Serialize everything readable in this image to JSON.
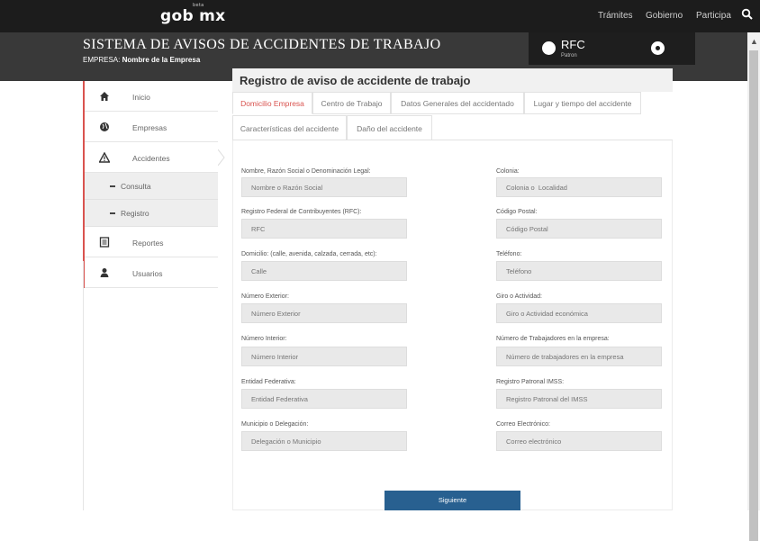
{
  "topbar": {
    "logo_text": "gob mx",
    "logo_badge": "beta",
    "nav": [
      "Trámites",
      "Gobierno",
      "Participa"
    ]
  },
  "header": {
    "title": "SISTEMA DE AVISOS DE ACCIDENTES DE TRABAJO",
    "empresa_label": "EMPRESA:",
    "empresa_value": "Nombre de la Empresa",
    "rfc": "RFC",
    "rfc_sub": "Patron"
  },
  "sidebar": {
    "items": [
      {
        "label": "Inicio",
        "icon": "home-icon"
      },
      {
        "label": "Empresas",
        "icon": "globe-icon"
      },
      {
        "label": "Accidentes",
        "icon": "warning-icon"
      },
      {
        "label": "Consulta",
        "icon": "dash-icon"
      },
      {
        "label": "Registro",
        "icon": "dash-icon"
      },
      {
        "label": "Reportes",
        "icon": "report-icon"
      },
      {
        "label": "Usuarios",
        "icon": "user-icon"
      }
    ]
  },
  "main": {
    "title": "Registro de aviso de accidente de trabajo",
    "tabs": [
      "Domicilio Empresa",
      "Centro de Trabajo",
      "Datos Generales del accidentado",
      "Lugar y tiempo del accidente",
      "Características del accidente",
      "Daño del accidente"
    ],
    "form": {
      "left": [
        {
          "label": "Nombre, Razón Social o Denominación Legal:",
          "placeholder": "Nombre o Razón Social"
        },
        {
          "label": "Registro Federal de Contribuyentes (RFC):",
          "placeholder": "RFC"
        },
        {
          "label": "Domicilio: (calle, avenida, calzada, cerrada, etc):",
          "placeholder": "Calle"
        },
        {
          "label": "Número Exterior:",
          "placeholder": "Número Exterior"
        },
        {
          "label": "Número Interior:",
          "placeholder": "Número Interior"
        },
        {
          "label": "Entidad Federativa:",
          "placeholder": "Entidad Federativa"
        },
        {
          "label": "Municipio o Delegación:",
          "placeholder": "Delegación o Municipio"
        }
      ],
      "right": [
        {
          "label": "Colonia:",
          "placeholder": "Colonia o  Localidad"
        },
        {
          "label": "Código Postal:",
          "placeholder": "Código Postal"
        },
        {
          "label": "Teléfono:",
          "placeholder": "Teléfono"
        },
        {
          "label": "Giro o Actividad:",
          "placeholder": "Giro o Actividad económica"
        },
        {
          "label": "Número de Trabajadores en la empresa:",
          "placeholder": "Número de trabajadores en la empresa"
        },
        {
          "label": "Registro Patronal IMSS:",
          "placeholder": "Registro Patronal del IMSS"
        },
        {
          "label": "Correo Electrónico:",
          "placeholder": "Correo electrónico"
        }
      ]
    },
    "next_button": "Siguiente"
  },
  "colors": {
    "accent": "#d9534f",
    "primary_button": "#286090",
    "header_bg": "#393939",
    "topbar_bg": "#1c1c1c"
  }
}
